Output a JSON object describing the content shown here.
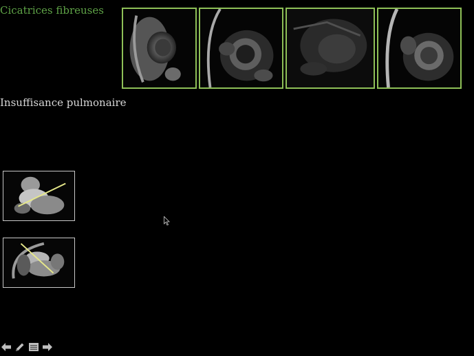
{
  "slide": {
    "heading_scars": "Cicatrices fibreuses",
    "heading_regurgitation": "Insuffisance pulmonaire"
  },
  "colors": {
    "background": "#000000",
    "heading_green": "#5fa347",
    "frame_green": "#8fc158",
    "heading_white": "#d8d8d8",
    "scan_line": "#e6e88a"
  },
  "mri_panels": [
    {
      "view": "short-axis"
    },
    {
      "view": "short-axis"
    },
    {
      "view": "long-axis"
    },
    {
      "view": "short-axis"
    }
  ],
  "thumbnails": [
    {
      "view": "outflow-tract"
    },
    {
      "view": "oblique"
    }
  ],
  "navigation": {
    "icons": [
      "arrow-left-icon",
      "pen-icon",
      "menu-icon",
      "arrow-right-icon"
    ]
  }
}
